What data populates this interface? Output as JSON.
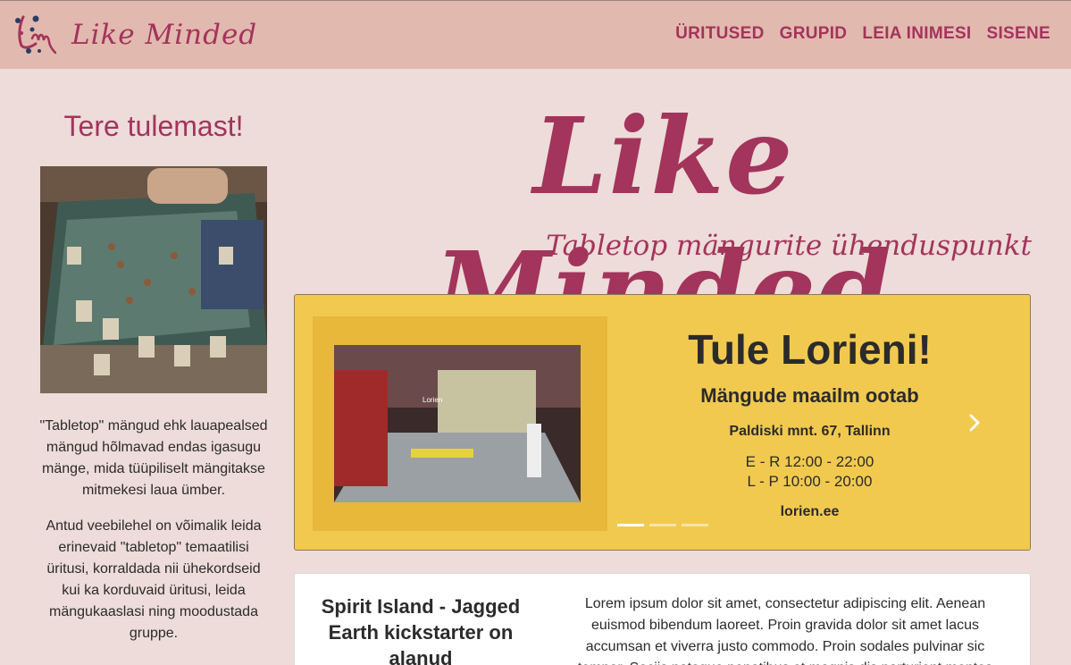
{
  "brand": {
    "name": "Like Minded",
    "logo_icon": "lm-monogram-logo-icon"
  },
  "nav": {
    "items": [
      "ÜRITUSED",
      "GRUPID",
      "LEIA INIMESI",
      "SISENE"
    ]
  },
  "sidebar": {
    "welcome": "Tere tulemast!",
    "paragraphs": [
      "\"Tabletop\" mängud ehk lauapealsed mängud hõlmavad endas igasugu mänge, mida tüüpiliselt mängitakse mitmekesi laua ümber.",
      "Antud veebilehel on võimalik leida erinevaid \"tabletop\" temaatilisi üritusi, korraldada nii ühekordseid kui ka korduvaid üritusi, leida mängukaaslasi ning moodustada gruppe."
    ]
  },
  "hero": {
    "title": "Like Minded",
    "subtitle": "Tabletop mängurite ühenduspunkt"
  },
  "carousel": {
    "title": "Tule Lorieni!",
    "subtitle": "Mängude maailm ootab",
    "address": "Paldiski mnt. 67, Tallinn",
    "hours": [
      "E - R 12:00 - 22:00",
      "L - P 10:00 - 20:00"
    ],
    "url": "lorien.ee",
    "shop_sign": "Lorien",
    "slide_count": 3,
    "active_slide": 1,
    "background_color": "#f2c94f",
    "next_icon": "chevron-right-icon"
  },
  "news": {
    "title": "Spirit Island - Jagged Earth kickstarter on alanud",
    "body": "Lorem ipsum dolor sit amet, consectetur adipiscing elit. Aenean euismod bibendum laoreet. Proin gravida dolor sit amet lacus accumsan et viverra justo commodo. Proin sodales pulvinar sic tempor. Sociis natoque penatibus et magnis dis parturient montes"
  },
  "colors": {
    "accent": "#a3345c",
    "navbar": "#e2b9ae",
    "page": "#eddcd9"
  }
}
